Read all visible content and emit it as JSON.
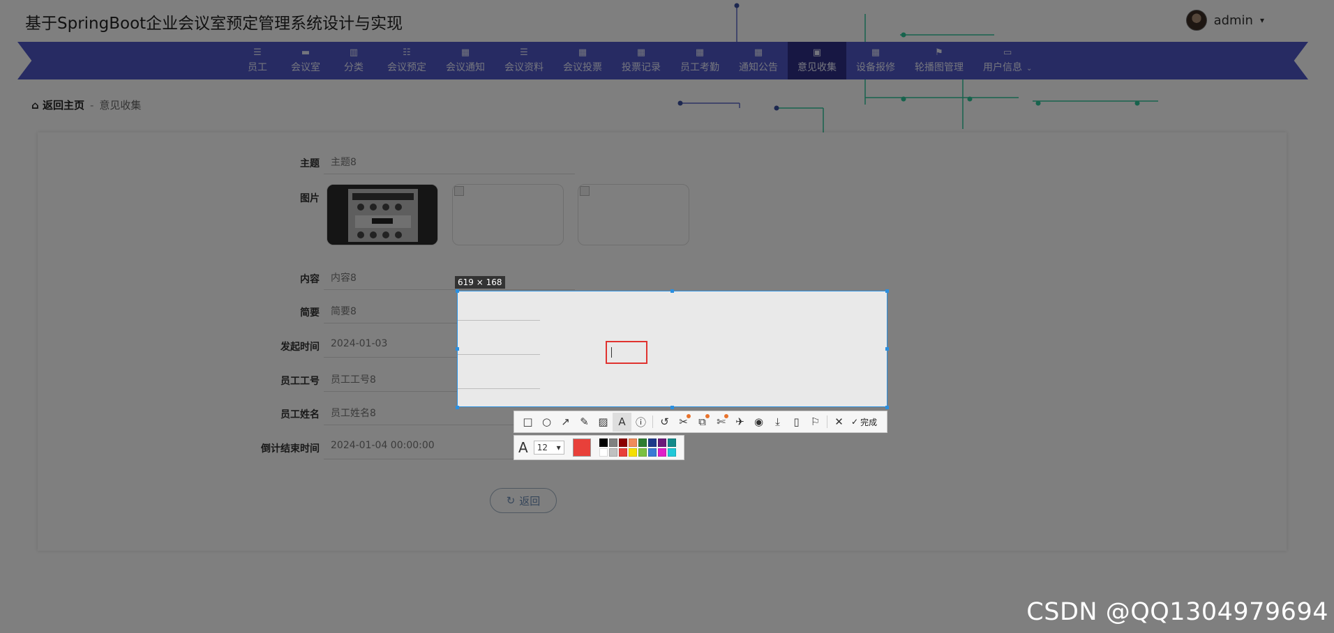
{
  "app": {
    "title": "基于SpringBoot企业会议室预定管理系统设计与实现"
  },
  "user": {
    "name": "admin",
    "caret": "▾"
  },
  "nav": {
    "items": [
      {
        "label": "员工",
        "icon": "list-icon",
        "glyph": "☰"
      },
      {
        "label": "会议室",
        "icon": "monitor-icon",
        "glyph": "▬"
      },
      {
        "label": "分类",
        "icon": "bar-chart-icon",
        "glyph": "▥"
      },
      {
        "label": "会议预定",
        "icon": "sliders-icon",
        "glyph": "☷"
      },
      {
        "label": "会议通知",
        "icon": "grid-icon",
        "glyph": "▦"
      },
      {
        "label": "会议资料",
        "icon": "list-icon",
        "glyph": "☰"
      },
      {
        "label": "会议投票",
        "icon": "grid-icon",
        "glyph": "▦"
      },
      {
        "label": "投票记录",
        "icon": "grid-icon",
        "glyph": "▦"
      },
      {
        "label": "员工考勤",
        "icon": "grid-icon",
        "glyph": "▦"
      },
      {
        "label": "通知公告",
        "icon": "grid-icon",
        "glyph": "▦"
      },
      {
        "label": "意见收集",
        "icon": "briefcase-icon",
        "glyph": "▣",
        "active": true
      },
      {
        "label": "设备报修",
        "icon": "grid-icon",
        "glyph": "▦"
      },
      {
        "label": "轮播图管理",
        "icon": "flag-icon",
        "glyph": "⚑"
      },
      {
        "label": "用户信息",
        "icon": "card-icon",
        "glyph": "▭",
        "dropdown": "⌄"
      }
    ],
    "color": "#4f57c7",
    "active_color": "#2f2f86"
  },
  "breadcrumb": {
    "home": "返回主页",
    "sep": "-",
    "current": "意见收集",
    "home_glyph": "⌂"
  },
  "form": {
    "subject": {
      "label": "主题",
      "value": "主题8"
    },
    "image": {
      "label": "图片"
    },
    "content": {
      "label": "内容",
      "value": "内容8"
    },
    "summary": {
      "label": "简要",
      "value": "简要8"
    },
    "start_time": {
      "label": "发起时间",
      "value": "2024-01-03"
    },
    "emp_no": {
      "label": "员工工号",
      "value": "员工工号8"
    },
    "emp_name": {
      "label": "员工姓名",
      "value": "员工姓名8"
    },
    "end_time": {
      "label": "倒计结束时间",
      "value": "2024-01-04 00:00:00"
    },
    "back_button": {
      "label": "返回",
      "glyph": "↻"
    }
  },
  "screenshot": {
    "size_label": "619 × 168",
    "tools": [
      {
        "name": "rectangle-tool",
        "glyph": "□"
      },
      {
        "name": "ellipse-tool",
        "glyph": "○"
      },
      {
        "name": "arrow-tool",
        "glyph": "↗"
      },
      {
        "name": "pen-tool",
        "glyph": "✎"
      },
      {
        "name": "mosaic-tool",
        "glyph": "▨"
      },
      {
        "name": "text-tool",
        "glyph": "A",
        "active": true
      },
      {
        "name": "serial-number-tool",
        "glyph": "ⓘ"
      },
      {
        "name": "undo-tool",
        "glyph": "↺"
      },
      {
        "name": "scissors-tool",
        "glyph": "✂",
        "badge": true
      },
      {
        "name": "translate-tool",
        "glyph": "⧉",
        "badge": true
      },
      {
        "name": "scissors-extra-tool",
        "glyph": "✄",
        "badge": true
      },
      {
        "name": "pin-tool",
        "glyph": "✈"
      },
      {
        "name": "record-tool",
        "glyph": "◉"
      },
      {
        "name": "download-tool",
        "glyph": "⤓"
      },
      {
        "name": "phone-tool",
        "glyph": "▯"
      },
      {
        "name": "bookmark-tool",
        "glyph": "⚐"
      },
      {
        "name": "close-tool",
        "glyph": "✕"
      }
    ],
    "done_glyph": "✓",
    "done_label": "完成",
    "font_glyph": "A",
    "font_size": "12",
    "font_caret": "▾",
    "current_color": "#e8403a",
    "palette": [
      "#000000",
      "#808080",
      "#8b0000",
      "#f08c5a",
      "#2e7d32",
      "#1e3a8a",
      "#6b1b7a",
      "#138a8a",
      "#ffffff",
      "#c0c0c0",
      "#e8403a",
      "#f5e000",
      "#7bc142",
      "#3a7bd5",
      "#e020c8",
      "#20c8d8"
    ]
  },
  "watermark": "CSDN @QQ1304979694"
}
